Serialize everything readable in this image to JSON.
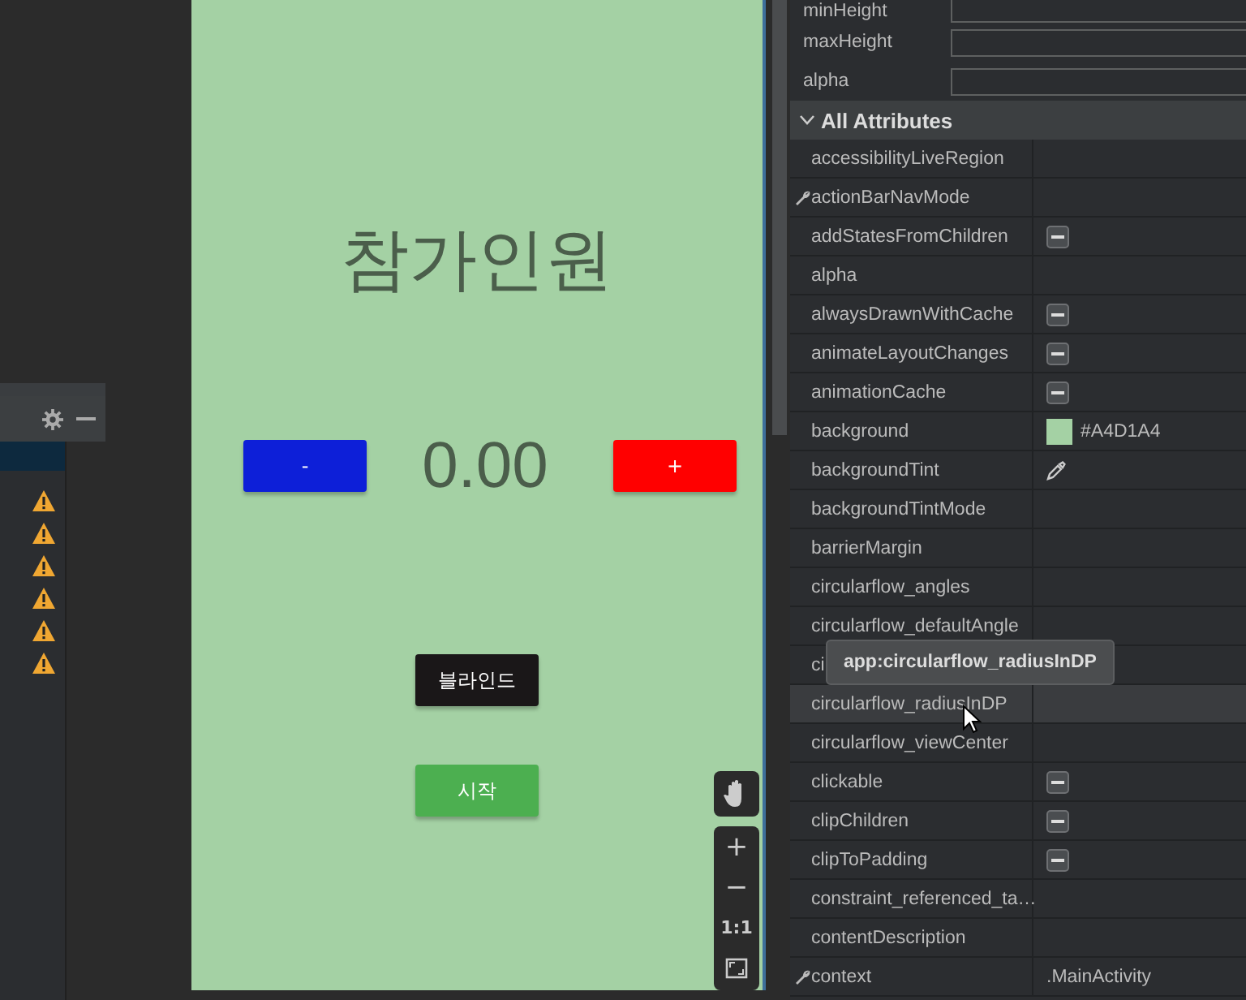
{
  "issues_panel": {
    "rows": [
      {
        "selected": true,
        "warning": false
      },
      {
        "selected": false,
        "warning": true
      },
      {
        "selected": false,
        "warning": true
      },
      {
        "selected": false,
        "warning": true
      },
      {
        "selected": false,
        "warning": true
      },
      {
        "selected": false,
        "warning": true
      },
      {
        "selected": false,
        "warning": true
      }
    ]
  },
  "preview": {
    "title": "참가인원",
    "minus_button": "-",
    "counter": "0.00",
    "plus_button": "+",
    "blind_button": "블라인드",
    "start_button": "시작",
    "zoom_controls": {
      "zoom_in": "+",
      "zoom_out": "−",
      "actual_size": "1:1"
    }
  },
  "attributes": {
    "top_rows": [
      {
        "name": "minHeight"
      },
      {
        "name": "maxHeight"
      },
      {
        "name": "alpha"
      }
    ],
    "section": {
      "title": "All Attributes",
      "expanded": true
    },
    "rows": [
      {
        "name": "accessibilityLiveRegion",
        "wrench": false,
        "hovered": false,
        "kind": "empty"
      },
      {
        "name": "actionBarNavMode",
        "wrench": true,
        "hovered": false,
        "kind": "empty"
      },
      {
        "name": "addStatesFromChildren",
        "wrench": false,
        "hovered": false,
        "kind": "flag"
      },
      {
        "name": "alpha",
        "wrench": false,
        "hovered": false,
        "kind": "empty"
      },
      {
        "name": "alwaysDrawnWithCache",
        "wrench": false,
        "hovered": false,
        "kind": "flag"
      },
      {
        "name": "animateLayoutChanges",
        "wrench": false,
        "hovered": false,
        "kind": "flag"
      },
      {
        "name": "animationCache",
        "wrench": false,
        "hovered": false,
        "kind": "flag"
      },
      {
        "name": "background",
        "wrench": false,
        "hovered": false,
        "kind": "color",
        "value": "#A4D1A4",
        "color": "#a4d1a4"
      },
      {
        "name": "backgroundTint",
        "wrench": false,
        "hovered": false,
        "kind": "picker"
      },
      {
        "name": "backgroundTintMode",
        "wrench": false,
        "hovered": false,
        "kind": "empty"
      },
      {
        "name": "barrierMargin",
        "wrench": false,
        "hovered": false,
        "kind": "empty"
      },
      {
        "name": "circularflow_angles",
        "wrench": false,
        "hovered": false,
        "kind": "empty"
      },
      {
        "name": "circularflow_defaultAngle",
        "wrench": false,
        "hovered": false,
        "kind": "empty"
      },
      {
        "name": "ci",
        "wrench": false,
        "hovered": false,
        "kind": "empty"
      },
      {
        "name": "circularflow_radiusInDP",
        "wrench": false,
        "hovered": true,
        "kind": "empty"
      },
      {
        "name": "circularflow_viewCenter",
        "wrench": false,
        "hovered": false,
        "kind": "empty"
      },
      {
        "name": "clickable",
        "wrench": false,
        "hovered": false,
        "kind": "flag"
      },
      {
        "name": "clipChildren",
        "wrench": false,
        "hovered": false,
        "kind": "flag"
      },
      {
        "name": "clipToPadding",
        "wrench": false,
        "hovered": false,
        "kind": "flag"
      },
      {
        "name": "constraint_referenced_ta…",
        "wrench": false,
        "hovered": false,
        "kind": "empty"
      },
      {
        "name": "contentDescription",
        "wrench": false,
        "hovered": false,
        "kind": "empty"
      },
      {
        "name": "context",
        "wrench": true,
        "hovered": false,
        "kind": "text",
        "value": ".MainActivity"
      }
    ],
    "tooltip": "app:circularflow_radiusInDP"
  }
}
